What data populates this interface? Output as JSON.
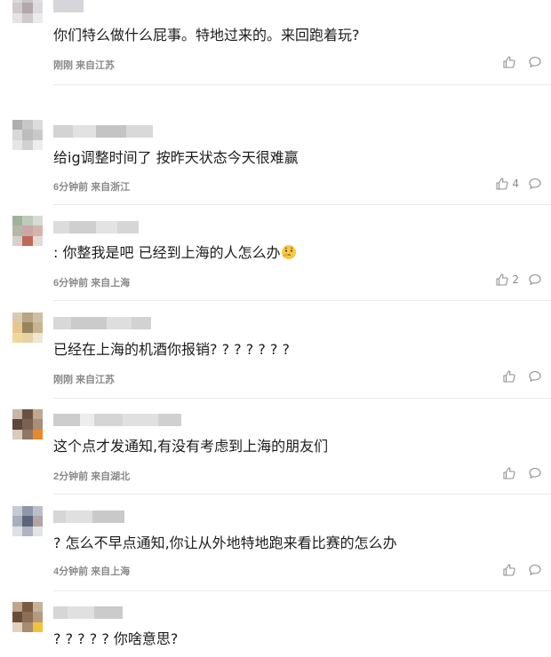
{
  "comments": [
    {
      "text": "你们特么做什么屁事。特地过来的。来回跑着玩?",
      "time": "刚刚",
      "location": "来自江苏",
      "likes": ""
    },
    {
      "text": "给ig调整时间了 按昨天状态今天很难赢",
      "time": "6分钟前",
      "location": "来自浙江",
      "likes": "4"
    },
    {
      "text": ": 你整我是吧 已经到上海的人怎么办",
      "time": "6分钟前",
      "location": "来自上海",
      "likes": "2",
      "emoji": "thinking-emoji"
    },
    {
      "text": "已经在上海的机酒你报销? ? ? ? ? ? ?",
      "time": "刚刚",
      "location": "来自江苏",
      "likes": ""
    },
    {
      "text": "这个点才发通知,有没有考虑到上海的朋友们",
      "time": "2分钟前",
      "location": "来自湖北",
      "likes": ""
    },
    {
      "text": "? 怎么不早点通知,你让从外地特地跑来看比赛的怎么办",
      "time": "4分钟前",
      "location": "来自上海",
      "likes": ""
    },
    {
      "text": "? ? ? ? ? 你啥意思?",
      "time": "",
      "location": "",
      "likes": ""
    }
  ],
  "icons": {
    "like": "thumbs-up-icon",
    "reply": "comment-bubble-icon"
  },
  "colors": {
    "text": "#1c1c1c",
    "meta": "#8a8a8a",
    "icon": "#8f8f8f",
    "divider": "#ebebeb"
  }
}
